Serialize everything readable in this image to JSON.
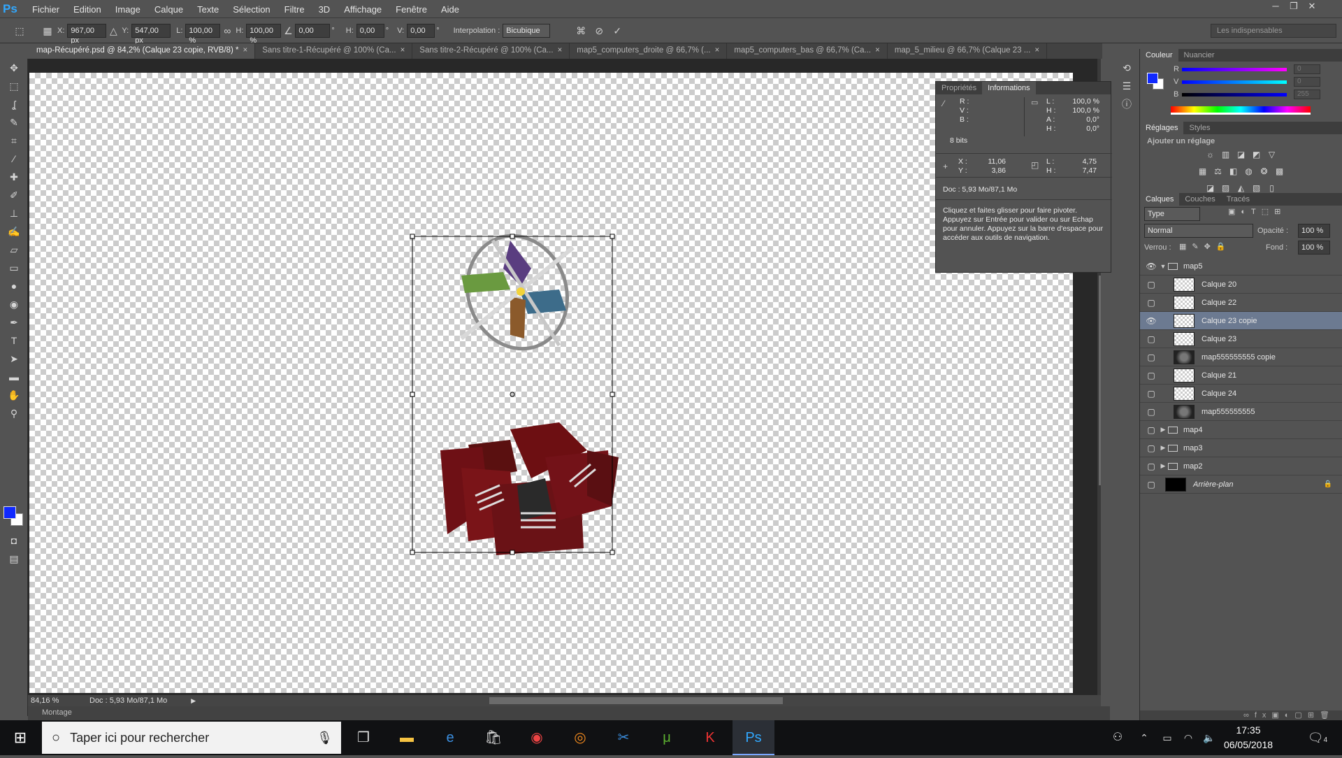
{
  "app": {
    "logo": "Ps"
  },
  "menu": [
    "Fichier",
    "Edition",
    "Image",
    "Calque",
    "Texte",
    "Sélection",
    "Filtre",
    "3D",
    "Affichage",
    "Fenêtre",
    "Aide"
  ],
  "window_controls": [
    "─",
    "❐",
    "✕"
  ],
  "options": {
    "x_label": "X:",
    "x_value": "967,00 px",
    "y_label": "Y:",
    "y_value": "547,00 px",
    "w_label": "L:",
    "w_value": "100,00 %",
    "h_label": "H:",
    "h_value": "100,00 %",
    "angle_value": "0,00",
    "hskew_label": "H:",
    "hskew_value": "0,00",
    "vskew_label": "V:",
    "vskew_value": "0,00",
    "interp_label": "Interpolation :",
    "interp_value": "Bicubique",
    "workspace": "Les indispensables"
  },
  "tabs": [
    {
      "label": "map-Récupéré.psd @ 84,2% (Calque 23 copie, RVB/8) *",
      "active": true
    },
    {
      "label": "Sans titre-1-Récupéré @ 100% (Ca..."
    },
    {
      "label": "Sans titre-2-Récupéré @ 100% (Ca..."
    },
    {
      "label": "map5_computers_droite @ 66,7% (..."
    },
    {
      "label": "map5_computers_bas @ 66,7% (Ca..."
    },
    {
      "label": "map_5_milieu @ 66,7% (Calque 23 ..."
    }
  ],
  "status": {
    "zoom": "84,16 %",
    "doc": "Doc : 5,93 Mo/87,1 Mo"
  },
  "montage": "Montage",
  "info_panel": {
    "tabs": [
      "Propriétés",
      "Informations"
    ],
    "r_label": "R :",
    "v_label": "V :",
    "b_label": "B :",
    "bits": "8 bits",
    "l_label": "L :",
    "l_value": "100,0 %",
    "h_label": "H :",
    "h_value": "100,0 %",
    "a_label": "A :",
    "a_value": "0,0°",
    "h2_label": "H :",
    "h2_value": "0,0°",
    "x_label": "X :",
    "x_value": "11,06",
    "y_label": "Y :",
    "y_value": "3,86",
    "l2_label": "L :",
    "l2_value": "4,75",
    "h3_label": "H :",
    "h3_value": "7,47",
    "doc": "Doc : 5,93 Mo/87,1 Mo",
    "hint": "Cliquez et faites glisser pour faire pivoter. Appuyez sur Entrée pour valider ou sur Echap pour annuler. Appuyez sur la barre d'espace pour accéder aux outils de navigation."
  },
  "color_panel": {
    "tabs": [
      "Couleur",
      "Nuancier"
    ],
    "r_label": "R",
    "r_value": "0",
    "v_label": "V",
    "v_value": "0",
    "b_label": "B",
    "b_value": "255",
    "fg": "#1029ff"
  },
  "adjust_panel": {
    "tabs": [
      "Réglages",
      "Styles"
    ],
    "add_label": "Ajouter un réglage"
  },
  "layers_panel": {
    "tabs": [
      "Calques",
      "Couches",
      "Tracés"
    ],
    "filter": "Type",
    "blend": "Normal",
    "opacity_label": "Opacité :",
    "opacity_value": "100 %",
    "lock_label": "Verrou :",
    "fill_label": "Fond :",
    "fill_value": "100 %",
    "layers": [
      {
        "name": "map5",
        "group": true,
        "open": true,
        "visible": true
      },
      {
        "name": "Calque 20",
        "indent": true
      },
      {
        "name": "Calque 22",
        "indent": true
      },
      {
        "name": "Calque 23 copie",
        "indent": true,
        "visible": true,
        "selected": true
      },
      {
        "name": "Calque 23",
        "indent": true
      },
      {
        "name": "map555555555 copie",
        "indent": true,
        "photo": true
      },
      {
        "name": "Calque 21",
        "indent": true
      },
      {
        "name": "Calque 24",
        "indent": true
      },
      {
        "name": "map555555555",
        "indent": true,
        "photo": true
      },
      {
        "name": "map4",
        "group": true
      },
      {
        "name": "map3",
        "group": true
      },
      {
        "name": "map2",
        "group": true
      },
      {
        "name": "Arrière-plan",
        "background": true
      }
    ]
  },
  "taskbar": {
    "search_placeholder": "Taper ici pour rechercher",
    "time": "17:35",
    "date": "06/05/2018",
    "notif_count": "4"
  }
}
